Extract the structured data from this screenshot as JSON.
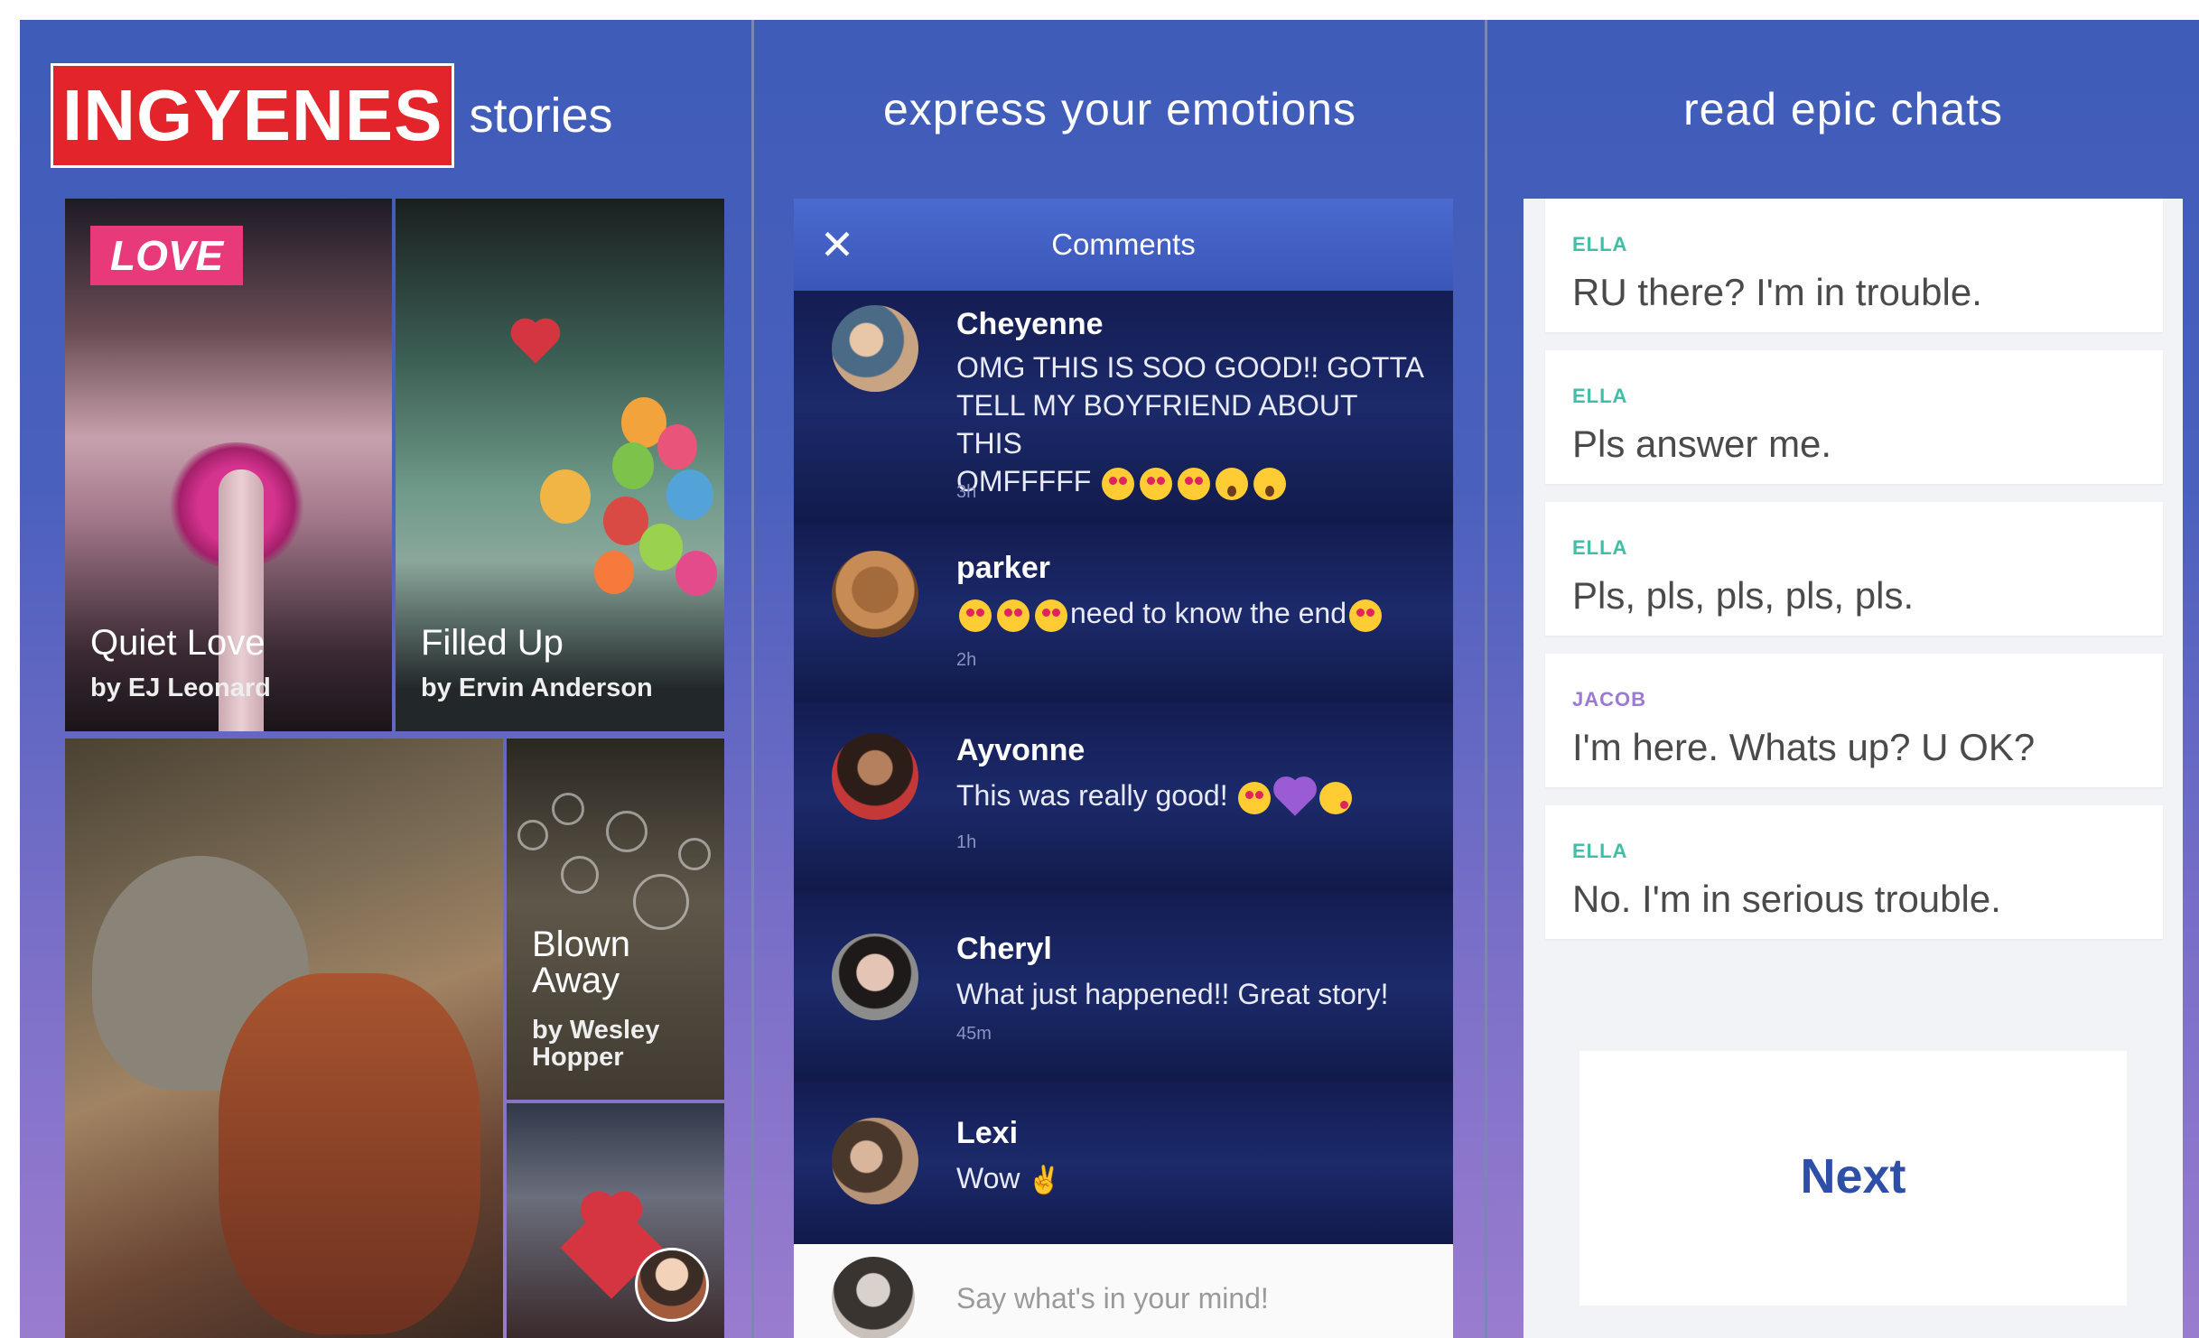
{
  "panel1": {
    "brand": "INGYENES",
    "brand_suffix": "stories",
    "badge": "LOVE",
    "stories": [
      {
        "title": "Quiet Love",
        "author": "by EJ Leonard"
      },
      {
        "title": "Filled Up",
        "author": "by Ervin Anderson"
      },
      {
        "title_line1": "Blown",
        "title_line2": "Away",
        "author_line1": "by Wesley",
        "author_line2": "Hopper"
      }
    ]
  },
  "panel2": {
    "title": "express your emotions",
    "header": {
      "title": "Comments",
      "close_icon": "close-icon"
    },
    "comments": [
      {
        "name": "Cheyenne",
        "line1": "OMG THIS IS SOO GOOD!! GOTTA",
        "line2": "TELL MY BOYFRIEND ABOUT THIS",
        "line3": "OMFFFFF",
        "time": "3h"
      },
      {
        "name": "parker",
        "text": "need to know the end",
        "time": "2h"
      },
      {
        "name": "Ayvonne",
        "text": "This was really good!",
        "time": "1h"
      },
      {
        "name": "Cheryl",
        "text": "What just happened!! Great story!",
        "time": "45m"
      },
      {
        "name": "Lexi",
        "text": "Wow"
      }
    ],
    "compose_placeholder": "Say what's in your mind!"
  },
  "panel3": {
    "title": "read epic chats",
    "messages": [
      {
        "sender": "ELLA",
        "text": "RU there? I'm in trouble."
      },
      {
        "sender": "ELLA",
        "text": "Pls answer me."
      },
      {
        "sender": "ELLA",
        "text": "Pls, pls, pls, pls, pls."
      },
      {
        "sender": "JACOB",
        "text": "I'm here. Whats up? U OK?"
      },
      {
        "sender": "ELLA",
        "text": "No. I'm in serious trouble."
      }
    ],
    "next_label": "Next"
  },
  "colors": {
    "brand_red": "#e3242b",
    "love_pink": "#e8397a",
    "panel_blue": "#3e5cb8",
    "panel_purple": "#9a7ccf",
    "ella_teal": "#3fbfa8",
    "jacob_purple": "#9b7ad6",
    "next_blue": "#2d4fa7"
  }
}
